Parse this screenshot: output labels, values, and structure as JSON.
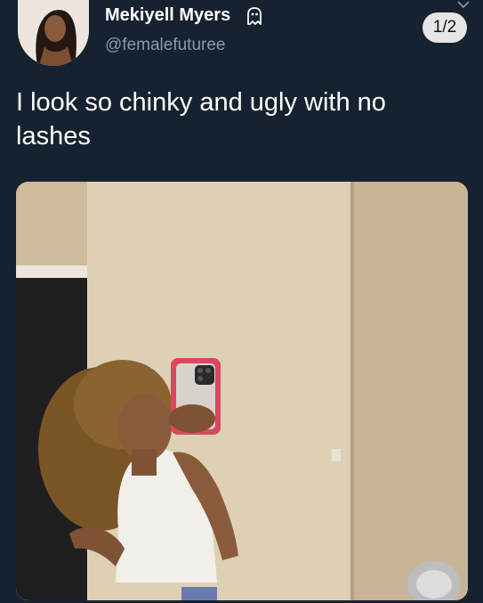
{
  "tweet": {
    "display_name": "Mekiyell Myers",
    "handle": "@femalefuturee",
    "text": "I look so chinky and ugly with no lashes",
    "media_counter": "1/2",
    "name_badge_icon": "ghost-icon",
    "menu_icon": "chevron-down-icon"
  },
  "colors": {
    "background": "#162230",
    "primary_text": "#ffffff",
    "secondary_text": "#8899a6",
    "phone_case": "#e0455f"
  }
}
